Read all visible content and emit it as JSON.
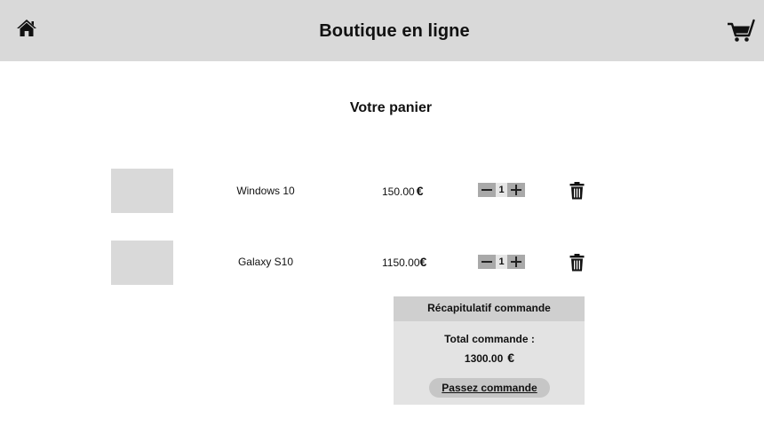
{
  "header": {
    "title": "Boutique en ligne",
    "home_icon": "home-icon",
    "cart_icon": "shopping-cart-icon"
  },
  "page": {
    "title": "Votre panier"
  },
  "cart": {
    "items": [
      {
        "name": "Windows 10",
        "price": "150.00",
        "currency": "€",
        "quantity": "1"
      },
      {
        "name": "Galaxy S10",
        "price": "1150.00",
        "currency": "€",
        "quantity": "1"
      }
    ]
  },
  "summary": {
    "header": "Récapitulatif commande",
    "total_label": "Total commande :",
    "total_value": "1300.00",
    "currency": "€",
    "order_button": "Passez commande"
  },
  "colors": {
    "header_bg": "#d9d9d9",
    "thumb_bg": "#d9d9d9",
    "summary_bg": "#e3e3e3",
    "button_bg": "#c6c6c6"
  }
}
